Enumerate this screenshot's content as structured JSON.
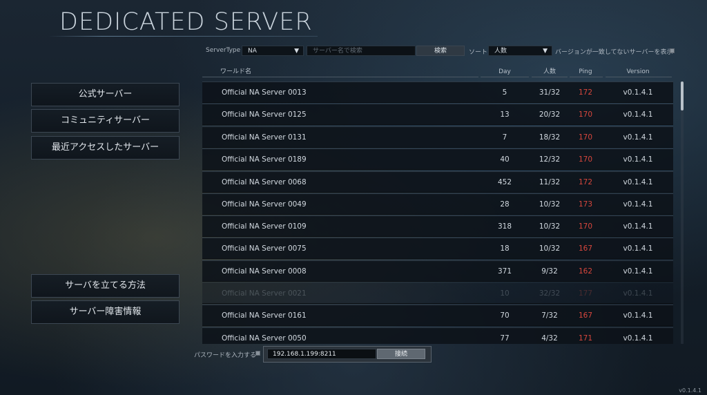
{
  "page_title": "DEDICATED SERVER",
  "filters": {
    "server_type_label": "ServerType",
    "server_type_value": "NA",
    "search_placeholder": "サーバー名で検索",
    "search_button": "検索",
    "sort_label": "ソート",
    "sort_value": "人数",
    "version_mismatch_label": "バージョンが一致してないサーバーを表示"
  },
  "sidebar": {
    "items": [
      {
        "label": "公式サーバー"
      },
      {
        "label": "コミュニティサーバー"
      },
      {
        "label": "最近アクセスしたサーバー"
      }
    ],
    "bottom_items": [
      {
        "label": "サーバを立てる方法"
      },
      {
        "label": "サーバー障害情報"
      }
    ]
  },
  "table": {
    "columns": {
      "name": "ワールド名",
      "day": "Day",
      "players": "人数",
      "ping": "Ping",
      "version": "Version"
    },
    "rows": [
      {
        "name": "Official NA Server 0013",
        "day": "5",
        "players": "31/32",
        "ping": "172",
        "version": "v0.1.4.1"
      },
      {
        "name": "Official NA Server 0125",
        "day": "13",
        "players": "20/32",
        "ping": "170",
        "version": "v0.1.4.1"
      },
      {
        "name": "Official NA Server 0131",
        "day": "7",
        "players": "18/32",
        "ping": "170",
        "version": "v0.1.4.1"
      },
      {
        "name": "Official NA Server 0189",
        "day": "40",
        "players": "12/32",
        "ping": "170",
        "version": "v0.1.4.1"
      },
      {
        "name": "Official NA Server 0068",
        "day": "452",
        "players": "11/32",
        "ping": "172",
        "version": "v0.1.4.1"
      },
      {
        "name": "Official NA Server 0049",
        "day": "28",
        "players": "10/32",
        "ping": "173",
        "version": "v0.1.4.1"
      },
      {
        "name": "Official NA Server 0109",
        "day": "318",
        "players": "10/32",
        "ping": "170",
        "version": "v0.1.4.1"
      },
      {
        "name": "Official NA Server 0075",
        "day": "18",
        "players": "10/32",
        "ping": "167",
        "version": "v0.1.4.1"
      },
      {
        "name": "Official NA Server 0008",
        "day": "371",
        "players": "9/32",
        "ping": "162",
        "version": "v0.1.4.1"
      },
      {
        "name": "Official NA Server 0021",
        "day": "10",
        "players": "32/32",
        "ping": "177",
        "version": "v0.1.4.1"
      },
      {
        "name": "Official NA Server 0161",
        "day": "70",
        "players": "7/32",
        "ping": "167",
        "version": "v0.1.4.1"
      },
      {
        "name": "Official NA Server 0050",
        "day": "77",
        "players": "4/32",
        "ping": "171",
        "version": "v0.1.4.1"
      }
    ]
  },
  "password": {
    "label": "パスワードを入力する",
    "ip_value": "192.168.1.199:8211",
    "connect_button": "接続"
  },
  "corner_version": "v0.1.4.1",
  "colors": {
    "ping": "#d9473d",
    "accent": "#b9c2ca"
  }
}
